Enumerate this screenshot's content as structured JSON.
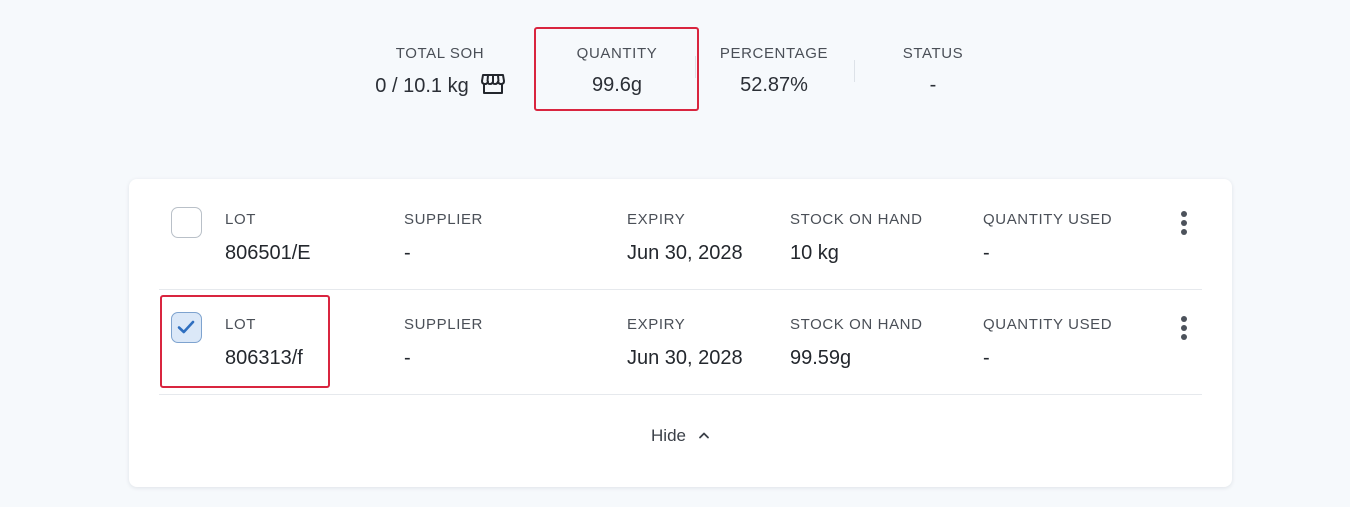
{
  "summary": {
    "total_soh": {
      "label": "TOTAL SOH",
      "value": "0 / 10.1 kg",
      "icon": "store-icon"
    },
    "quantity": {
      "label": "QUANTITY",
      "value": "99.6g"
    },
    "percentage": {
      "label": "PERCENTAGE",
      "value": "52.87%"
    },
    "status": {
      "label": "STATUS",
      "value": "-"
    }
  },
  "columns": {
    "lot": "LOT",
    "supplier": "SUPPLIER",
    "expiry": "EXPIRY",
    "stock_on_hand": "STOCK ON HAND",
    "quantity_used": "QUANTITY USED"
  },
  "lots": [
    {
      "checked": false,
      "lot": "806501/E",
      "supplier": "-",
      "expiry": "Jun 30, 2028",
      "stock_on_hand": "10 kg",
      "quantity_used": "-"
    },
    {
      "checked": true,
      "lot": "806313/f",
      "supplier": "-",
      "expiry": "Jun 30, 2028",
      "stock_on_hand": "99.59g",
      "quantity_used": "-"
    }
  ],
  "toggle": {
    "label": "Hide",
    "icon": "chevron-up-icon"
  },
  "colors": {
    "highlight": "#d9253f",
    "checked_bg": "#dbe8f8",
    "check_mark": "#2f6fc0"
  }
}
